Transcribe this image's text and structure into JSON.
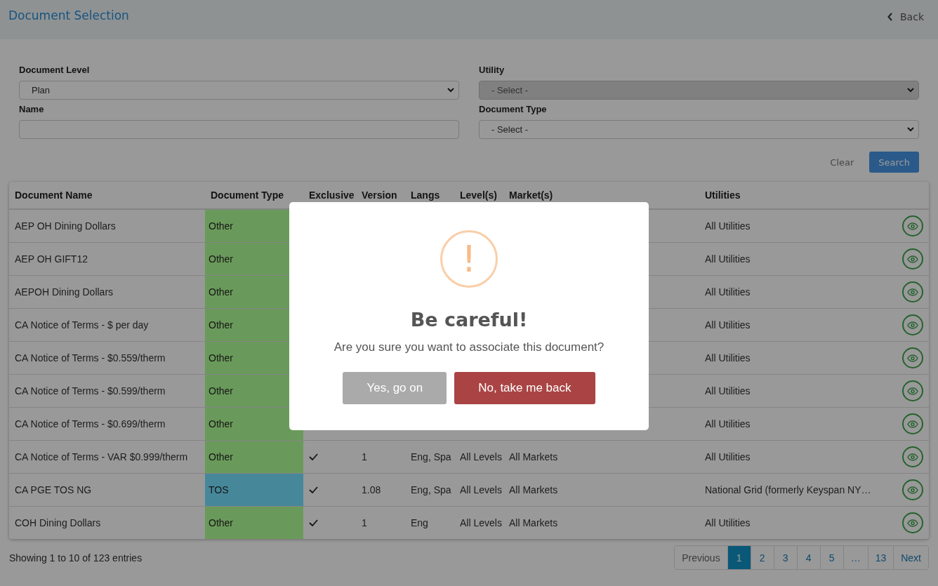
{
  "header": {
    "title": "Document Selection",
    "back": "Back"
  },
  "filters": [
    {
      "label": "Document Level",
      "kind": "select",
      "value": "Plan",
      "disabled": false
    },
    {
      "label": "Utility",
      "kind": "select",
      "value": "- Select -",
      "disabled": true
    },
    {
      "label": "Name",
      "kind": "text"
    },
    {
      "label": "Document Type",
      "kind": "select",
      "value": "- Select -",
      "disabled": false
    }
  ],
  "actions": {
    "clear": "Clear",
    "search": "Search"
  },
  "table": {
    "columns": [
      "Document Name",
      "Document Type",
      "Exclusive",
      "Version",
      "Langs",
      "Level(s)",
      "Market(s)",
      "Utilities"
    ],
    "rows": [
      {
        "name": "AEP OH Dining Dollars",
        "type": "Other",
        "color": "#6a9a5b",
        "utilities": "All Utilities"
      },
      {
        "name": "AEP OH GIFT12",
        "type": "Other",
        "color": "#6a9a5b",
        "utilities": "All Utilities"
      },
      {
        "name": "AEPOH Dining Dollars",
        "type": "Other",
        "color": "#6a9a5b",
        "utilities": "All Utilities"
      },
      {
        "name": "CA Notice of Terms - $ per day",
        "type": "Other",
        "color": "#6a9a5b",
        "utilities": "All Utilities"
      },
      {
        "name": "CA Notice of Terms - $0.559/therm",
        "type": "Other",
        "color": "#6a9a5b",
        "utilities": "All Utilities"
      },
      {
        "name": "CA Notice of Terms - $0.599/therm",
        "type": "Other",
        "color": "#6a9a5b",
        "utilities": "All Utilities"
      },
      {
        "name": "CA Notice of Terms - $0.699/therm",
        "type": "Other",
        "color": "#6a9a5b",
        "utilities": "All Utilities"
      },
      {
        "name": "CA Notice of Terms - VAR $0.999/therm",
        "type": "Other",
        "color": "#6a9a5b",
        "exclusive": true,
        "version": "1",
        "langs": "Eng, Spa",
        "levels": "All Levels",
        "markets": "All Markets",
        "utilities": "All Utilities"
      },
      {
        "name": "CA PGE TOS NG",
        "type": "TOS",
        "color": "#46879a",
        "exclusive": true,
        "version": "1.08",
        "langs": "Eng, Spa",
        "levels": "All Levels",
        "markets": "All Markets",
        "utilities": "National Grid (formerly Keyspan NY…"
      },
      {
        "name": "COH Dining Dollars",
        "type": "Other",
        "color": "#6a9a5b",
        "exclusive": true,
        "version": "1",
        "langs": "Eng",
        "levels": "All Levels",
        "markets": "All Markets",
        "utilities": "All Utilities"
      }
    ]
  },
  "footer": {
    "info": "Showing 1 to 10 of 123 entries",
    "previous": "Previous",
    "next": "Next",
    "pages": [
      {
        "label": "1",
        "selected": true
      },
      {
        "label": "2",
        "selected": false
      },
      {
        "label": "3",
        "selected": false
      },
      {
        "label": "4",
        "selected": false
      },
      {
        "label": "5",
        "selected": false
      },
      {
        "label": "…",
        "selected": false
      },
      {
        "label": "13",
        "selected": false
      }
    ]
  },
  "dialog": {
    "icon": "!",
    "title": "Be careful!",
    "message": "Are you sure you want to associate this document?",
    "confirm": "Yes, go on",
    "cancel": "No, take me back"
  }
}
